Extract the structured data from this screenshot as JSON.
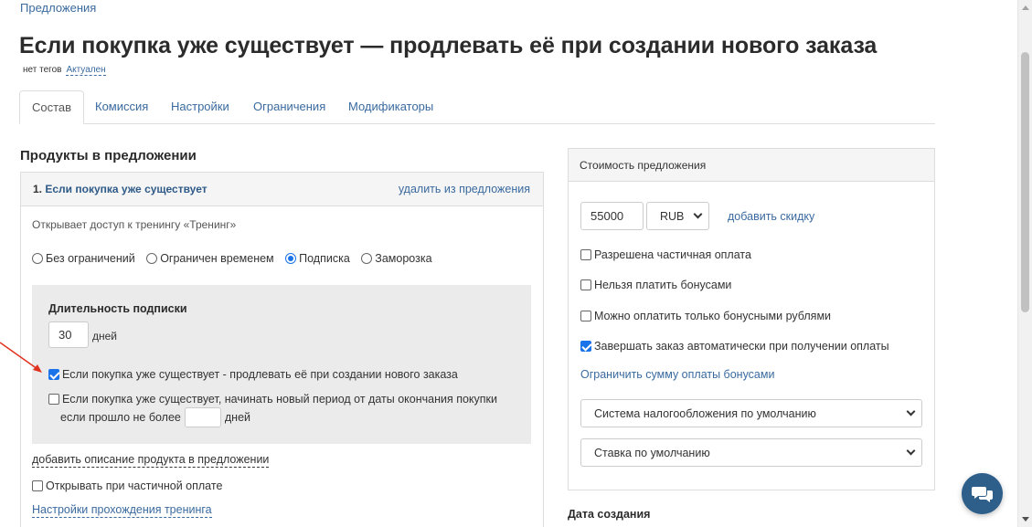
{
  "breadcrumb": "Предложения",
  "title": "Если покупка уже существует — продлевать её при создании нового заказа",
  "tags": {
    "no_tags": "нет тегов",
    "status": "Актуален"
  },
  "tabs": [
    "Состав",
    "Комиссия",
    "Настройки",
    "Ограничения",
    "Модификаторы"
  ],
  "products": {
    "section_title": "Продукты в предложении",
    "item": {
      "number": "1.",
      "name": "Если покупка уже существует",
      "remove_label": "удалить из предложения",
      "access_text": "Открывает доступ к тренингу «Тренинг»",
      "access_options": [
        {
          "label": "Без ограничений",
          "checked": false
        },
        {
          "label": "Ограничен временем",
          "checked": false
        },
        {
          "label": "Подписка",
          "checked": true
        },
        {
          "label": "Заморозка",
          "checked": false
        }
      ],
      "subscription": {
        "title": "Длительность подписки",
        "duration_value": "30",
        "duration_unit": "дней",
        "renew_label": "Если покупка уже существует - продлевать её при создании нового заказа",
        "renew_checked": true,
        "new_period_label": "Если покупка уже существует, начинать новый период от даты окончания покупки",
        "new_period_checked": false,
        "new_period_suffix_before": "если прошло не более",
        "new_period_value": "",
        "new_period_suffix_after": "дней"
      },
      "add_description": "добавить описание продукта в предложении",
      "open_on_partial_label": "Открывать при частичной оплате",
      "open_on_partial_checked": false,
      "training_settings": "Настройки прохождения тренинга"
    }
  },
  "price": {
    "header": "Стоимость предложения",
    "amount": "55000",
    "currency": "RUB",
    "add_discount": "добавить скидку",
    "options": [
      {
        "label": "Разрешена частичная оплата",
        "checked": false
      },
      {
        "label": "Нельзя платить бонусами",
        "checked": false
      },
      {
        "label": "Можно оплатить только бонусными рублями",
        "checked": false
      },
      {
        "label": "Завершать заказ автоматически при получении оплаты",
        "checked": true
      }
    ],
    "limit_bonus": "Ограничить сумму оплаты бонусами",
    "tax_system": "Система налогообложения по умолчанию",
    "tax_rate": "Ставка по умолчанию"
  },
  "created_title": "Дата создания",
  "colors": {
    "link": "#3a6a9f",
    "accent": "#1a73e8",
    "chat": "#2d5f8a",
    "arrow": "#e0311f"
  }
}
